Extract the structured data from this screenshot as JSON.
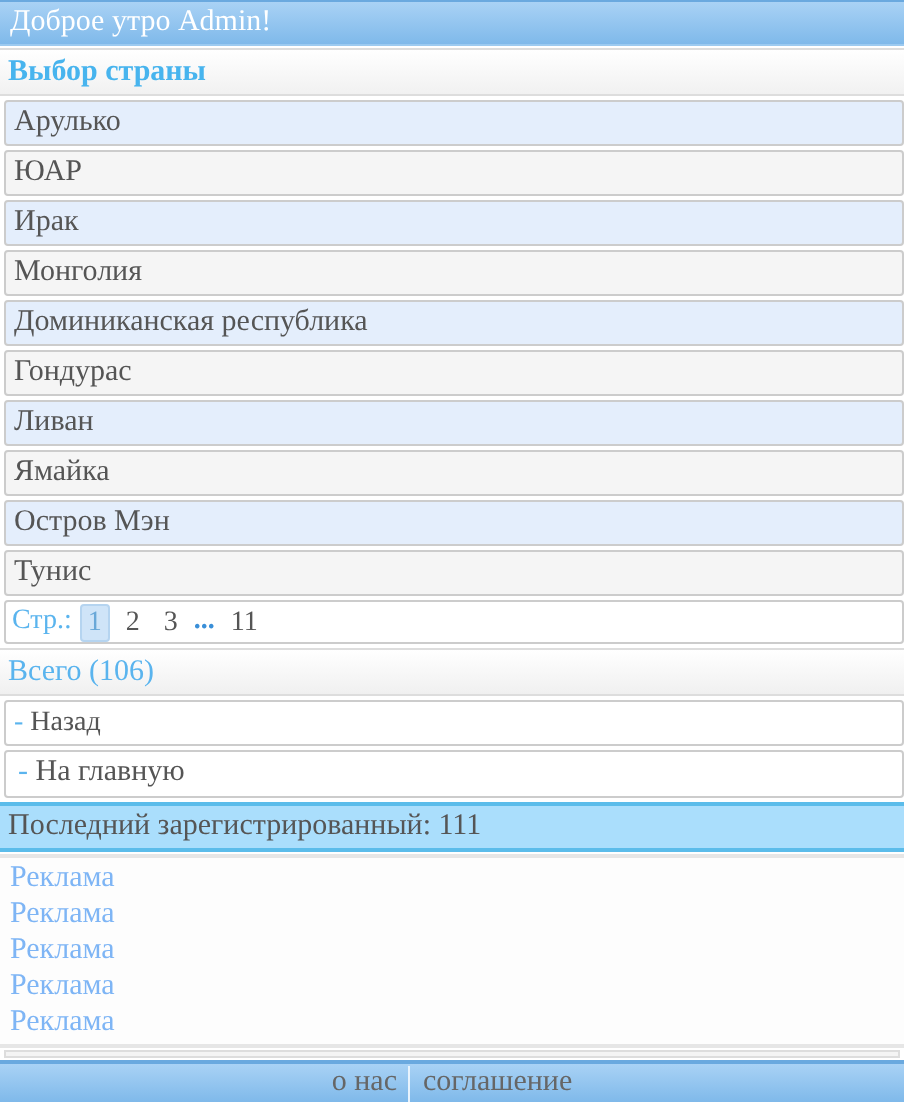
{
  "header": {
    "greeting": "Доброе утро  Admin!"
  },
  "section_title": "Выбор страны",
  "countries": [
    "Арулько",
    "ЮАР",
    "Ирак",
    "Монголия",
    "Доминиканская республика",
    "Гондурас",
    "Ливан",
    "Ямайка",
    "Остров Мэн",
    "Тунис"
  ],
  "pagination": {
    "label": "Стр.:",
    "pages": [
      {
        "kind": "page",
        "text": "1",
        "selected": true
      },
      {
        "kind": "page",
        "text": "2",
        "selected": false
      },
      {
        "kind": "page",
        "text": "3",
        "selected": false
      },
      {
        "kind": "ellipsis",
        "text": "..."
      },
      {
        "kind": "page",
        "text": "11",
        "selected": false
      }
    ]
  },
  "total": "Всего (106)",
  "nav_links": [
    {
      "marker": "-",
      "label": "Назад"
    },
    {
      "marker": "-",
      "label": "На главную"
    }
  ],
  "last_registered": "Последний зарегистрированный: 111",
  "ads": [
    "Реклама",
    "Реклама",
    "Реклама",
    "Реклама",
    "Реклама"
  ],
  "footer_links": [
    "о нас",
    "соглашение"
  ]
}
